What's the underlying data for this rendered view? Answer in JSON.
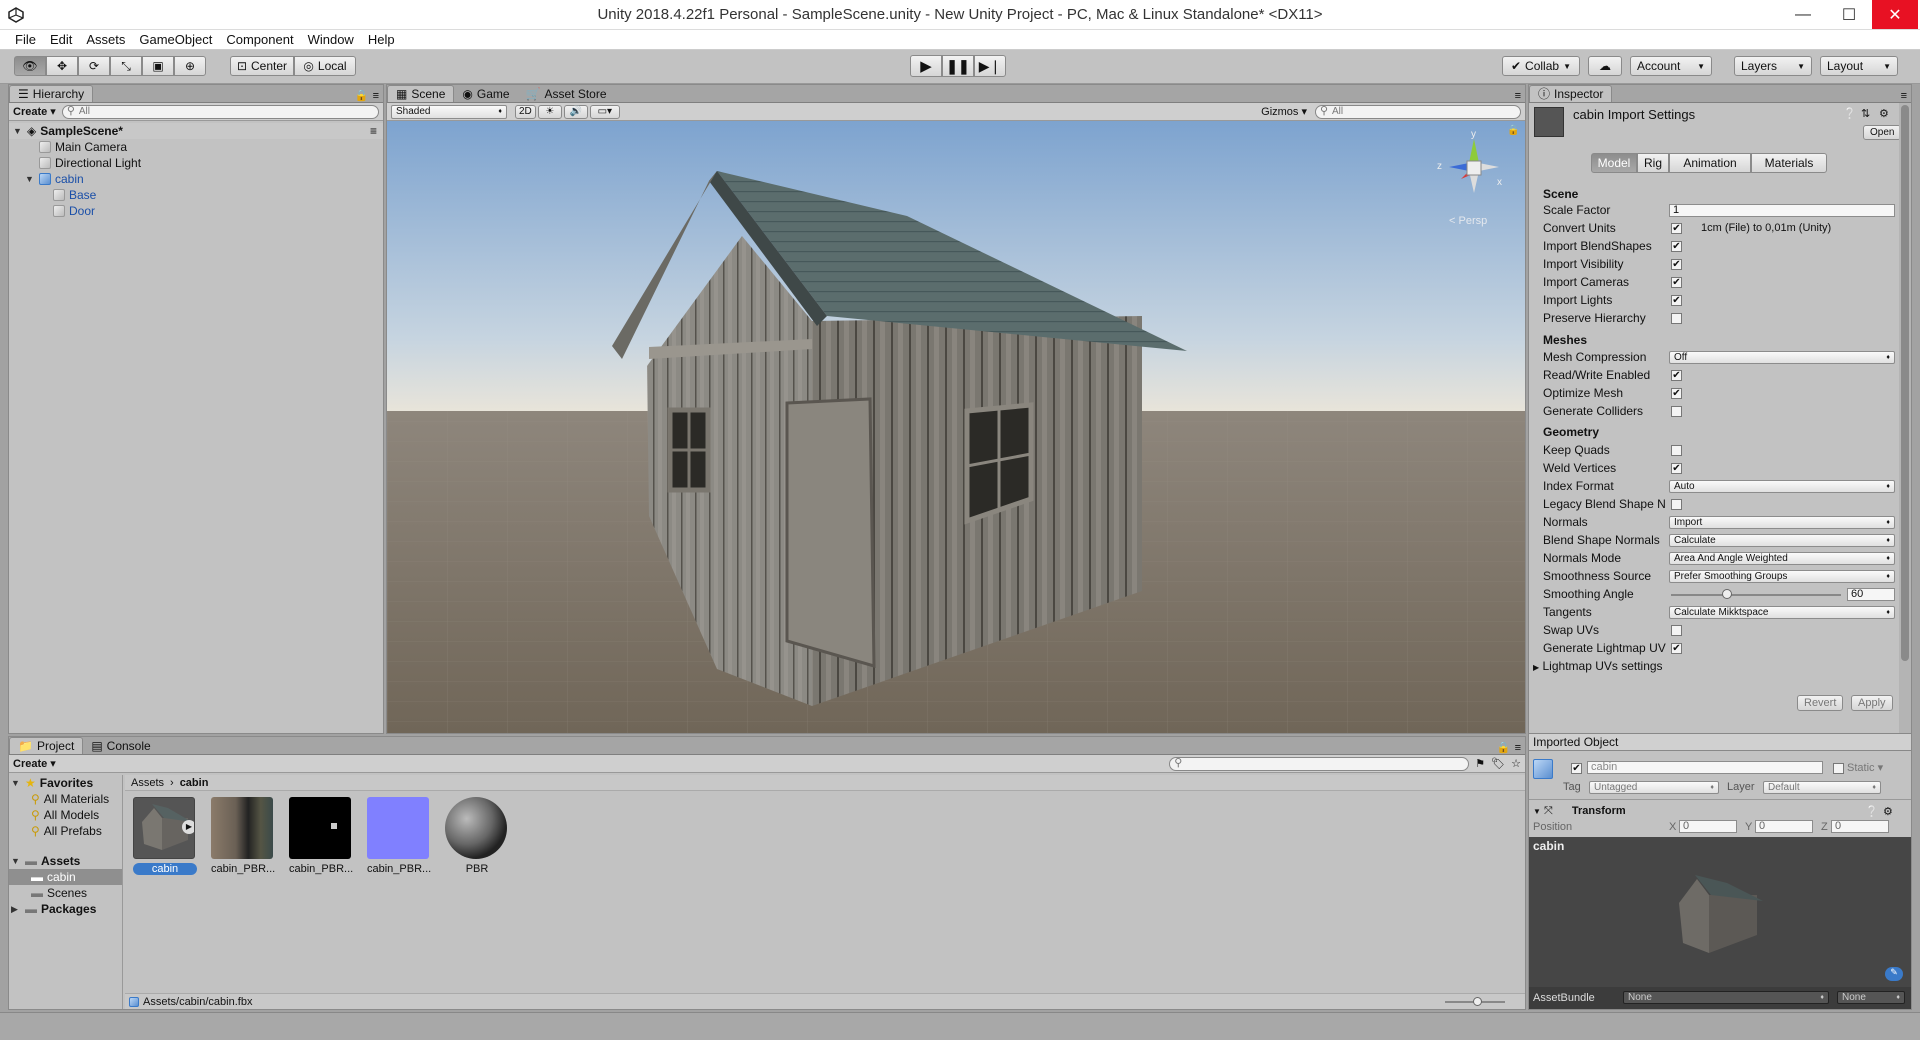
{
  "window": {
    "title": "Unity 2018.4.22f1 Personal - SampleScene.unity - New Unity Project - PC, Mac & Linux Standalone* <DX11>"
  },
  "menu": [
    "File",
    "Edit",
    "Assets",
    "GameObject",
    "Component",
    "Window",
    "Help"
  ],
  "toolbar": {
    "center": "Center",
    "local": "Local",
    "collab": "Collab",
    "account": "Account",
    "layers": "Layers",
    "layout": "Layout"
  },
  "hierarchy": {
    "tab": "Hierarchy",
    "create": "Create",
    "search_placeholder": "All",
    "scene": "SampleScene*",
    "items": [
      "Main Camera",
      "Directional Light",
      "cabin",
      "Base",
      "Door"
    ]
  },
  "scene_view": {
    "tabs": [
      "Scene",
      "Game",
      "Asset Store"
    ],
    "shading": "Shaded",
    "mode2d": "2D",
    "gizmos": "Gizmos",
    "search_placeholder": "All",
    "persp": "Persp",
    "axis_x": "x",
    "axis_z": "z",
    "axis_y": "y"
  },
  "project": {
    "tabs": [
      "Project",
      "Console"
    ],
    "create": "Create",
    "favorites": {
      "label": "Favorites",
      "items": [
        "All Materials",
        "All Models",
        "All Prefabs"
      ]
    },
    "assets": {
      "label": "Assets",
      "items": [
        "cabin",
        "Scenes"
      ]
    },
    "packages": "Packages",
    "breadcrumb": [
      "Assets",
      "cabin"
    ],
    "files": [
      "cabin",
      "cabin_PBR...",
      "cabin_PBR...",
      "cabin_PBR...",
      "PBR"
    ],
    "path": "Assets/cabin/cabin.fbx"
  },
  "inspector": {
    "tab": "Inspector",
    "title": "cabin Import Settings",
    "open": "Open",
    "tabs": [
      "Model",
      "Rig",
      "Animation",
      "Materials"
    ],
    "scene_header": "Scene",
    "scale_factor_label": "Scale Factor",
    "scale_factor": "1",
    "convert_units_label": "Convert Units",
    "convert_units_note": "1cm (File) to 0,01m (Unity)",
    "checks_scene": [
      {
        "label": "Import BlendShapes",
        "checked": true
      },
      {
        "label": "Import Visibility",
        "checked": true
      },
      {
        "label": "Import Cameras",
        "checked": true
      },
      {
        "label": "Import Lights",
        "checked": true
      },
      {
        "label": "Preserve Hierarchy",
        "checked": false
      }
    ],
    "meshes_header": "Meshes",
    "mesh_compression_label": "Mesh Compression",
    "mesh_compression": "Off",
    "checks_meshes": [
      {
        "label": "Read/Write Enabled",
        "checked": true
      },
      {
        "label": "Optimize Mesh",
        "checked": true
      },
      {
        "label": "Generate Colliders",
        "checked": false
      }
    ],
    "geometry_header": "Geometry",
    "keep_quads": "Keep Quads",
    "weld_vertices": "Weld Vertices",
    "index_format_label": "Index Format",
    "index_format": "Auto",
    "legacy_blend": "Legacy Blend Shape N",
    "normals_label": "Normals",
    "normals": "Import",
    "blend_normals_label": "Blend Shape Normals",
    "blend_normals": "Calculate",
    "normals_mode_label": "Normals Mode",
    "normals_mode": "Area And Angle Weighted",
    "smooth_source_label": "Smoothness Source",
    "smooth_source": "Prefer Smoothing Groups",
    "smooth_angle_label": "Smoothing Angle",
    "smooth_angle": "60",
    "smooth_angle_fraction": 0.33,
    "tangents_label": "Tangents",
    "tangents": "Calculate Mikktspace",
    "swap_uvs": "Swap UVs",
    "gen_lightmap": "Generate Lightmap UV",
    "lightmap_settings": "Lightmap UVs settings",
    "revert": "Revert",
    "apply": "Apply",
    "imported_object": "Imported Object",
    "object_name": "cabin",
    "static": "Static",
    "tag_label": "Tag",
    "tag": "Untagged",
    "layer_label": "Layer",
    "layer": "Default",
    "transform": "Transform",
    "position_label": "Position",
    "pos_x": "0",
    "pos_y": "0",
    "pos_z": "0",
    "x": "X",
    "y": "Y",
    "z": "Z",
    "preview_label": "cabin",
    "assetbundle_label": "AssetBundle",
    "assetbundle": "None",
    "variant": "None"
  }
}
